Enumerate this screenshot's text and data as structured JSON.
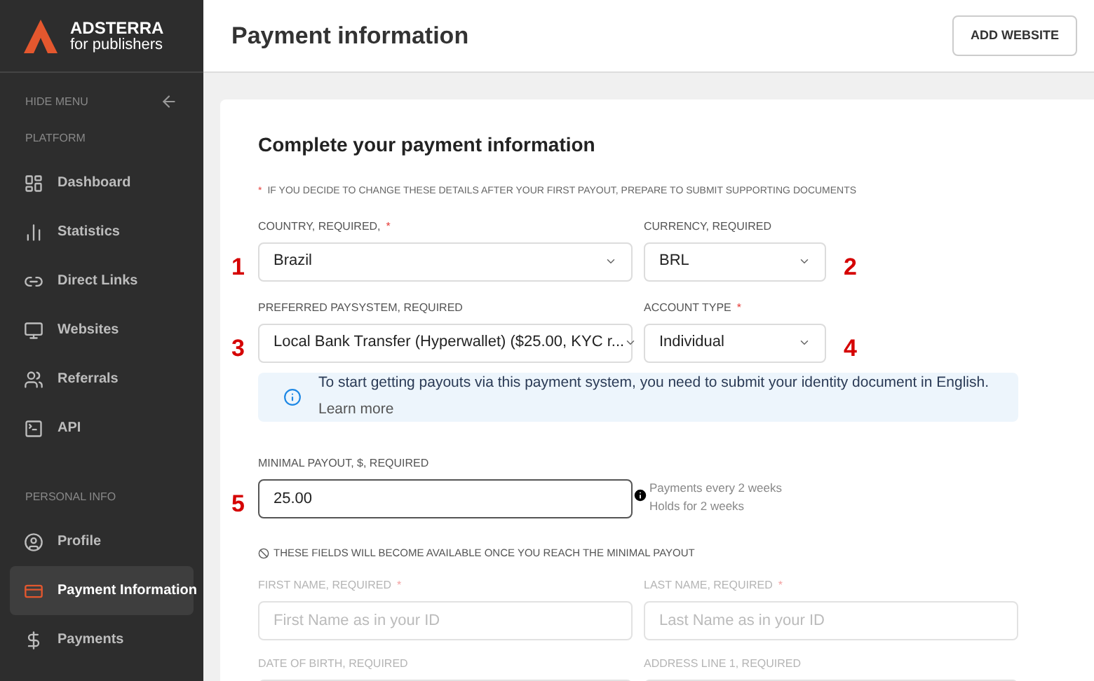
{
  "sidebar": {
    "logo": {
      "name": "ADSTERRA",
      "tagline": "for publishers"
    },
    "hide_menu": "HIDE MENU",
    "sections": [
      {
        "title": "PLATFORM",
        "items": [
          {
            "label": "Dashboard",
            "selected": false
          },
          {
            "label": "Statistics",
            "selected": false
          },
          {
            "label": "Direct Links",
            "selected": false
          },
          {
            "label": "Websites",
            "selected": false
          },
          {
            "label": "Referrals",
            "selected": false
          },
          {
            "label": "API",
            "selected": false
          }
        ]
      },
      {
        "title": "PERSONAL INFO",
        "items": [
          {
            "label": "Profile",
            "selected": false
          },
          {
            "label": "Payment Information",
            "selected": true
          },
          {
            "label": "Payments",
            "selected": false
          }
        ]
      }
    ]
  },
  "header": {
    "title": "Payment information",
    "button": "ADD WEBSITE"
  },
  "card": {
    "title": "Complete your payment information",
    "note_mark": "*",
    "note": "IF YOU DECIDE TO CHANGE THESE DETAILS AFTER YOUR FIRST PAYOUT, PREPARE TO SUBMIT SUPPORTING DOCUMENTS",
    "rows1": [
      [
        {
          "kind": "select",
          "label": "COUNTRY, REQUIRED,",
          "required_mark": "*",
          "value": "Brazil",
          "marker": "1"
        },
        {
          "kind": "select",
          "label": "CURRENCY, REQUIRED",
          "value": "BRL",
          "marker": "2"
        }
      ],
      [
        {
          "kind": "select",
          "label": "PREFERRED PAYSYSTEM, REQUIRED",
          "value": "Local Bank Transfer (Hyperwallet) ($25.00, KYC r...",
          "marker": "3"
        },
        {
          "kind": "select",
          "label": "ACCOUNT TYPE",
          "required_mark": "*",
          "value": "Individual",
          "marker": "4"
        }
      ]
    ],
    "info": {
      "text": "To start getting payouts via this payment system, you need to submit your identity document in English.",
      "link": "Learn more"
    },
    "payout": {
      "kind": "input",
      "label": "MINIMAL PAYOUT, $, REQUIRED",
      "value": "25.00",
      "marker": "5",
      "hints": [
        "Payments every 2 weeks",
        "Holds for 2 weeks"
      ]
    },
    "locked_note": "THESE FIELDS WILL BECOME AVAILABLE ONCE YOU REACH THE MINIMAL PAYOUT",
    "rows2": [
      [
        {
          "kind": "input",
          "label": "FIRST NAME, REQUIRED",
          "required_mark": "*",
          "placeholder": "First Name as in your ID",
          "disabled": true
        },
        {
          "kind": "input",
          "label": "LAST NAME, REQUIRED",
          "required_mark": "*",
          "placeholder": "Last Name as in your ID",
          "disabled": true
        }
      ],
      [
        {
          "kind": "input",
          "label": "DATE OF BIRTH, REQUIRED",
          "disabled": true
        },
        {
          "kind": "input",
          "label": "ADDRESS LINE 1, REQUIRED",
          "disabled": true
        }
      ]
    ]
  }
}
